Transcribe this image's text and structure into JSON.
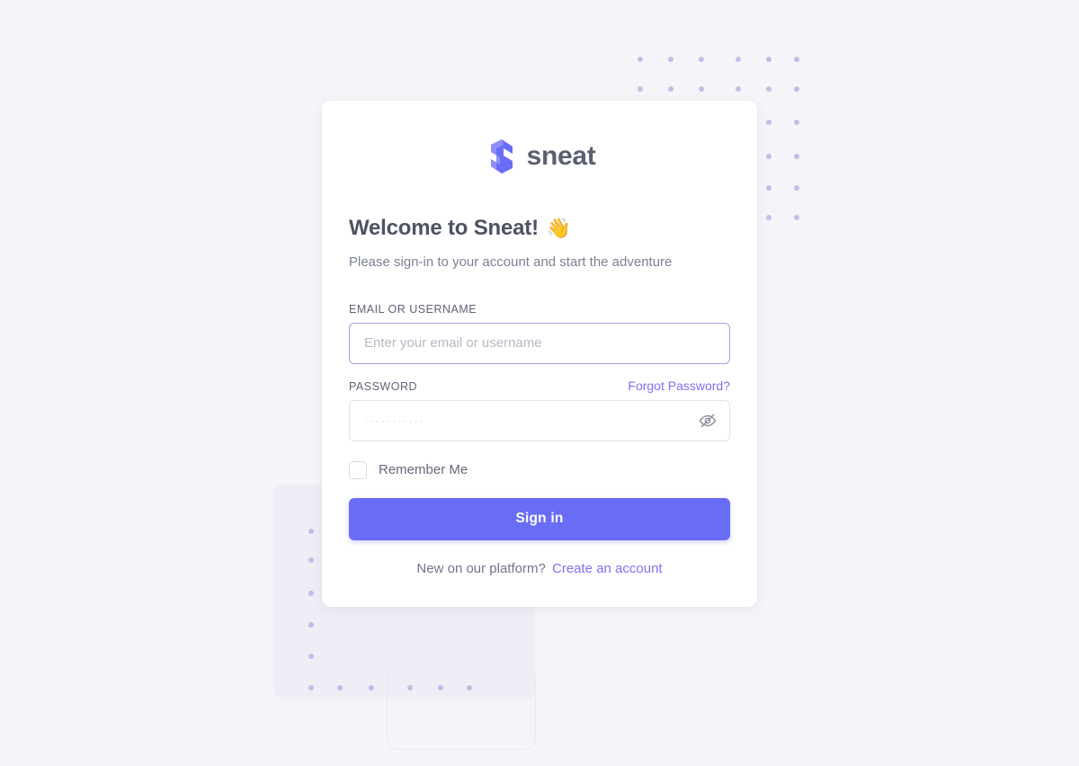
{
  "page": {
    "background_color": "#f5f5f9",
    "accent_color": "#696cf5",
    "link_color": "#7f70f0",
    "dot_color": "#b6b5e2"
  },
  "brand": {
    "logo_icon": "sneat-s-logo-icon",
    "name": "sneat"
  },
  "header": {
    "welcome_title": "Welcome to Sneat!",
    "wave_emoji": "👋",
    "subtitle": "Please sign-in to your account and start the adventure"
  },
  "form": {
    "email": {
      "label": "EMAIL OR USERNAME",
      "placeholder": "Enter your email or username",
      "value": "",
      "focused": true
    },
    "password": {
      "label": "PASSWORD",
      "forgot_label": "Forgot Password?",
      "masked_value": "···········",
      "visibility_icon": "eye-off-icon",
      "visible": false
    },
    "remember": {
      "label": "Remember Me",
      "checked": false
    },
    "submit_label": "Sign in"
  },
  "footer": {
    "prompt": "New on our platform?",
    "signup_label": "Create an account"
  },
  "decorations": {
    "top_right_dot_grid": {
      "columns": 6,
      "rows": 2
    },
    "right_dot_grid": {
      "columns": 2,
      "rows": 4
    },
    "bottom_left_dot_grid": {
      "columns": 1,
      "rows": 5
    },
    "bottom_dot_row": {
      "columns": 6,
      "rows": 1
    }
  }
}
